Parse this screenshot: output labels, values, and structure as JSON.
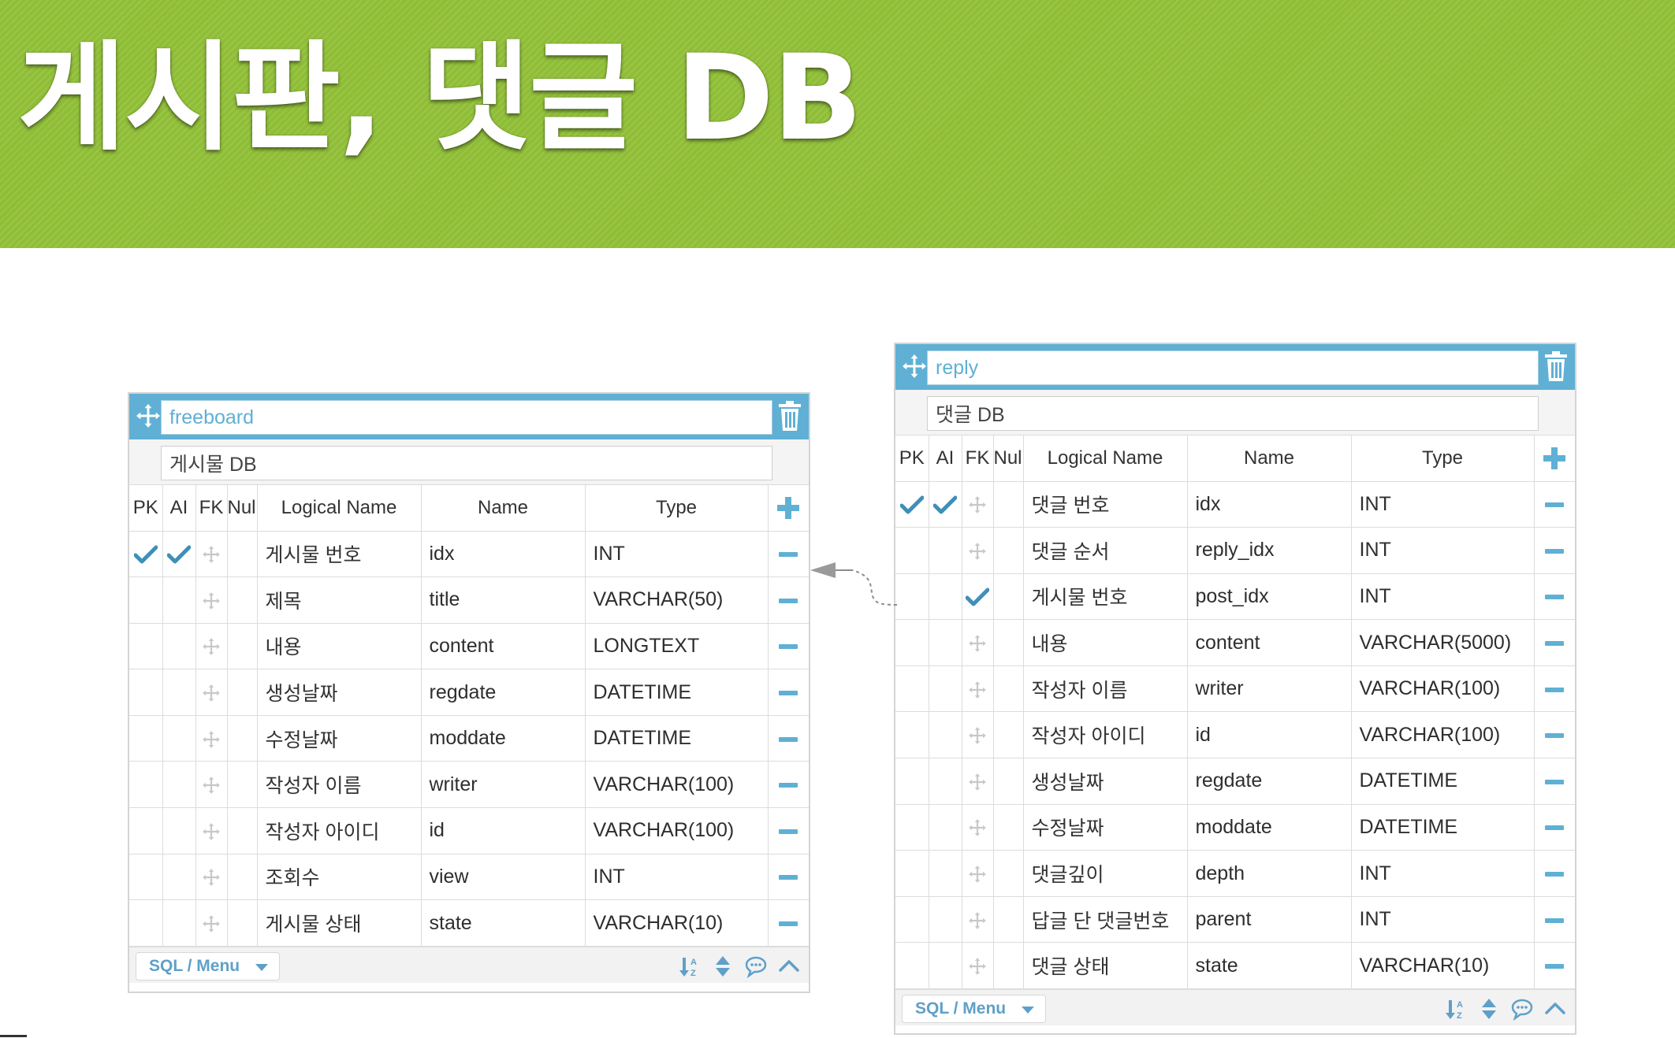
{
  "slide": {
    "title": "게시판, 댓글 DB"
  },
  "columns": [
    "PK",
    "AI",
    "FK",
    "Null",
    "Logical Name",
    "Name",
    "Type"
  ],
  "colors": {
    "banner": "#8fbe36",
    "header_blue": "#5fb0d4",
    "check_blue": "#3f8fb7"
  },
  "tables": [
    {
      "table_name": "freeboard",
      "comment": "게시물 DB",
      "rows": [
        {
          "pk": true,
          "ai": true,
          "fk": false,
          "logical": "게시물 번호",
          "name": "idx",
          "type": "INT"
        },
        {
          "pk": false,
          "ai": false,
          "fk": false,
          "logical": "제목",
          "name": "title",
          "type": "VARCHAR(50)"
        },
        {
          "pk": false,
          "ai": false,
          "fk": false,
          "logical": "내용",
          "name": "content",
          "type": "LONGTEXT"
        },
        {
          "pk": false,
          "ai": false,
          "fk": false,
          "logical": "생성날짜",
          "name": "regdate",
          "type": "DATETIME"
        },
        {
          "pk": false,
          "ai": false,
          "fk": false,
          "logical": "수정날짜",
          "name": "moddate",
          "type": "DATETIME"
        },
        {
          "pk": false,
          "ai": false,
          "fk": false,
          "logical": "작성자 이름",
          "name": "writer",
          "type": "VARCHAR(100)"
        },
        {
          "pk": false,
          "ai": false,
          "fk": false,
          "logical": "작성자 아이디",
          "name": "id",
          "type": "VARCHAR(100)"
        },
        {
          "pk": false,
          "ai": false,
          "fk": false,
          "logical": "조회수",
          "name": "view",
          "type": "INT"
        },
        {
          "pk": false,
          "ai": false,
          "fk": false,
          "logical": "게시물 상태",
          "name": "state",
          "type": "VARCHAR(10)"
        }
      ],
      "footer": {
        "menu_label": "SQL / Menu"
      }
    },
    {
      "table_name": "reply",
      "comment": "댓글 DB",
      "rows": [
        {
          "pk": true,
          "ai": true,
          "fk": false,
          "logical": "댓글 번호",
          "name": "idx",
          "type": "INT"
        },
        {
          "pk": false,
          "ai": false,
          "fk": false,
          "logical": "댓글 순서",
          "name": "reply_idx",
          "type": "INT"
        },
        {
          "pk": false,
          "ai": false,
          "fk": true,
          "logical": "게시물 번호",
          "name": "post_idx",
          "type": "INT"
        },
        {
          "pk": false,
          "ai": false,
          "fk": false,
          "logical": "내용",
          "name": "content",
          "type": "VARCHAR(5000)"
        },
        {
          "pk": false,
          "ai": false,
          "fk": false,
          "logical": "작성자 이름",
          "name": "writer",
          "type": "VARCHAR(100)"
        },
        {
          "pk": false,
          "ai": false,
          "fk": false,
          "logical": "작성자 아이디",
          "name": "id",
          "type": "VARCHAR(100)"
        },
        {
          "pk": false,
          "ai": false,
          "fk": false,
          "logical": "생성날짜",
          "name": "regdate",
          "type": "DATETIME"
        },
        {
          "pk": false,
          "ai": false,
          "fk": false,
          "logical": "수정날짜",
          "name": "moddate",
          "type": "DATETIME"
        },
        {
          "pk": false,
          "ai": false,
          "fk": false,
          "logical": "댓글깊이",
          "name": "depth",
          "type": "INT"
        },
        {
          "pk": false,
          "ai": false,
          "fk": false,
          "logical": "답글 단 댓글번호",
          "name": "parent",
          "type": "INT"
        },
        {
          "pk": false,
          "ai": false,
          "fk": false,
          "logical": "댓글 상태",
          "name": "state",
          "type": "VARCHAR(10)"
        }
      ],
      "footer": {
        "menu_label": "SQL / Menu"
      }
    }
  ],
  "relation": {
    "from": "reply.post_idx",
    "to": "freeboard.idx"
  }
}
